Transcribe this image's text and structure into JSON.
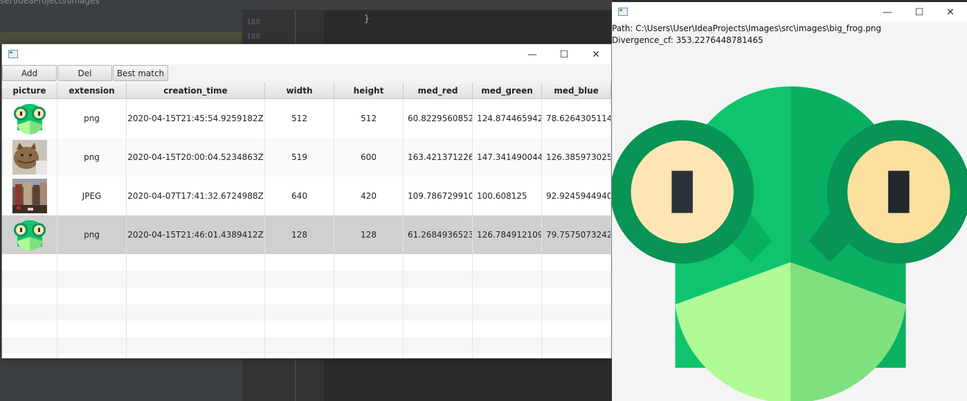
{
  "background": {
    "project_title": "ser\\IdeaProjects\\Images",
    "line_numbers": [
      "188",
      "189"
    ],
    "code_line": "}"
  },
  "main_window": {
    "controls": {
      "minimize": "—",
      "maximize": "☐",
      "close": "✕"
    },
    "toolbar": {
      "add_label": "Add",
      "del_label": "Del",
      "best_match_label": "Best match"
    },
    "columns": [
      "picture",
      "extension",
      "creation_time",
      "width",
      "height",
      "med_red",
      "med_green",
      "med_blue"
    ],
    "rows": [
      {
        "picture": "frog",
        "extension": "png",
        "creation_time": "2020-04-15T21:45:54.9259182Z",
        "width": "512",
        "height": "512",
        "med_red": "60.8229560852...",
        "med_green": "124.874465942...",
        "med_blue": "78.6264305114...",
        "selected": false
      },
      {
        "picture": "cat",
        "extension": "png",
        "creation_time": "2020-04-15T20:00:04.5234863Z",
        "width": "519",
        "height": "600",
        "med_red": "163.421371226...",
        "med_green": "147.341490044...",
        "med_blue": "126.385973025...",
        "selected": false
      },
      {
        "picture": "city",
        "extension": "JPEG",
        "creation_time": "2020-04-07T17:41:32.6724988Z",
        "width": "640",
        "height": "420",
        "med_red": "109.786729910...",
        "med_green": "100.608125",
        "med_blue": "92.9245944940...",
        "selected": false
      },
      {
        "picture": "frog",
        "extension": "png",
        "creation_time": "2020-04-15T21:46:01.4389412Z",
        "width": "128",
        "height": "128",
        "med_red": "61.2684936523...",
        "med_green": "126.784912109...",
        "med_blue": "79.7575073242...",
        "selected": true
      }
    ]
  },
  "viewer_window": {
    "controls": {
      "minimize": "—",
      "maximize": "☐",
      "close": "✕"
    },
    "path_text": "Path: C:\\Users\\User\\IdeaProjects\\Images\\src\\images\\big_frog.png",
    "divergence_text": "Divergence_cf: 353.2276448781465"
  },
  "colors": {
    "frog_green": "#10c46d",
    "frog_dark": "#079455",
    "frog_shade": "#0ab061",
    "eye_white": "#fde6b4",
    "mouth_light": "#b0fa96",
    "mouth_mid": "#7fe07f",
    "pupil": "#2b3238",
    "selected_row": "#d0d0d0"
  }
}
